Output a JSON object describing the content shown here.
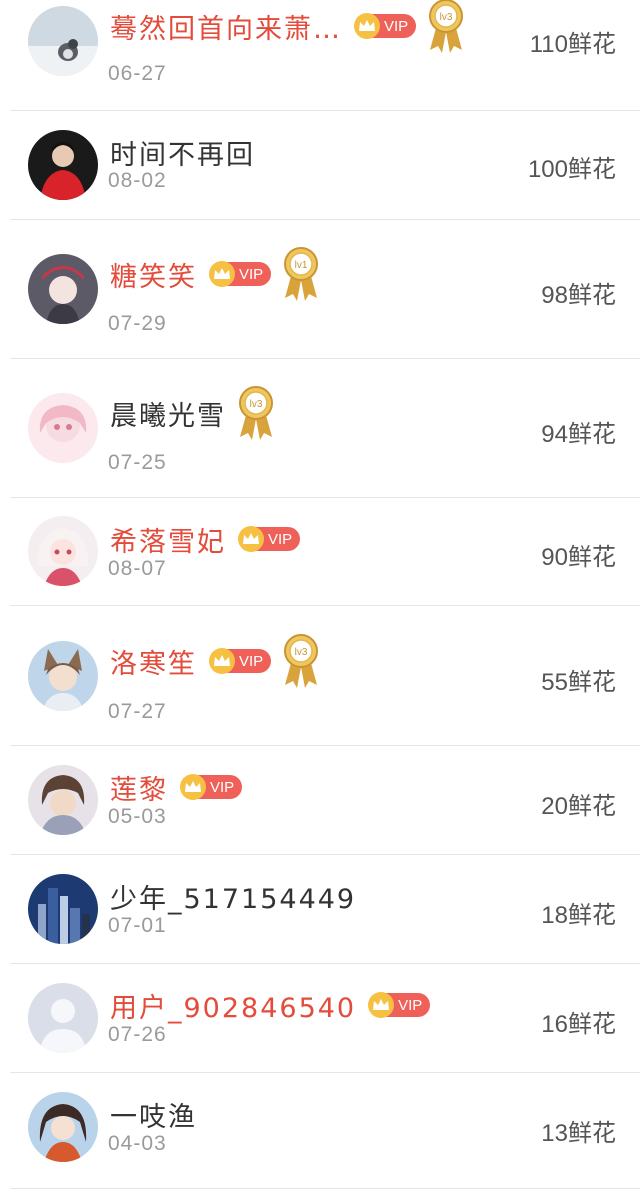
{
  "rows": [
    {
      "name": "蓦然回首向来萧…",
      "vip": true,
      "vip_label": "VIP",
      "level": "lv3",
      "date": "06-27",
      "flowers": "110鲜花",
      "avatar": "penguin"
    },
    {
      "name": "时间不再回",
      "vip": false,
      "vip_label": "",
      "level": "",
      "date": "08-02",
      "flowers": "100鲜花",
      "avatar": "girl-red"
    },
    {
      "name": "糖笑笑",
      "vip": true,
      "vip_label": "VIP",
      "level": "lv1",
      "date": "07-29",
      "flowers": "98鲜花",
      "avatar": "anime-red-hat"
    },
    {
      "name": "晨曦光雪",
      "vip": false,
      "vip_label": "",
      "level": "lv3",
      "date": "07-25",
      "flowers": "94鲜花",
      "avatar": "anime-pink"
    },
    {
      "name": "希落雪妃",
      "vip": true,
      "vip_label": "VIP",
      "level": "",
      "date": "08-07",
      "flowers": "90鲜花",
      "avatar": "anime-white"
    },
    {
      "name": "洛寒笙",
      "vip": true,
      "vip_label": "VIP",
      "level": "lv3",
      "date": "07-27",
      "flowers": "55鲜花",
      "avatar": "anime-fox"
    },
    {
      "name": "莲黎",
      "vip": true,
      "vip_label": "VIP",
      "level": "",
      "date": "05-03",
      "flowers": "20鲜花",
      "avatar": "anime-boy"
    },
    {
      "name": "少年_517154449",
      "vip": false,
      "vip_label": "",
      "level": "",
      "date": "07-01",
      "flowers": "18鲜花",
      "avatar": "city"
    },
    {
      "name": "用户_902846540",
      "vip": true,
      "vip_label": "VIP",
      "level": "",
      "date": "07-26",
      "flowers": "16鲜花",
      "avatar": "default-user"
    },
    {
      "name": "一吱渔",
      "vip": false,
      "vip_label": "",
      "level": "",
      "date": "04-03",
      "flowers": "13鲜花",
      "avatar": "anime-girl-scarf"
    }
  ],
  "colors": {
    "vip_name": "#e34b3b",
    "normal_name": "#333333",
    "vip_badge": "#ef6059",
    "crown": "#f6c143",
    "date": "#9a9a9a",
    "divider": "#e6e6e6"
  }
}
